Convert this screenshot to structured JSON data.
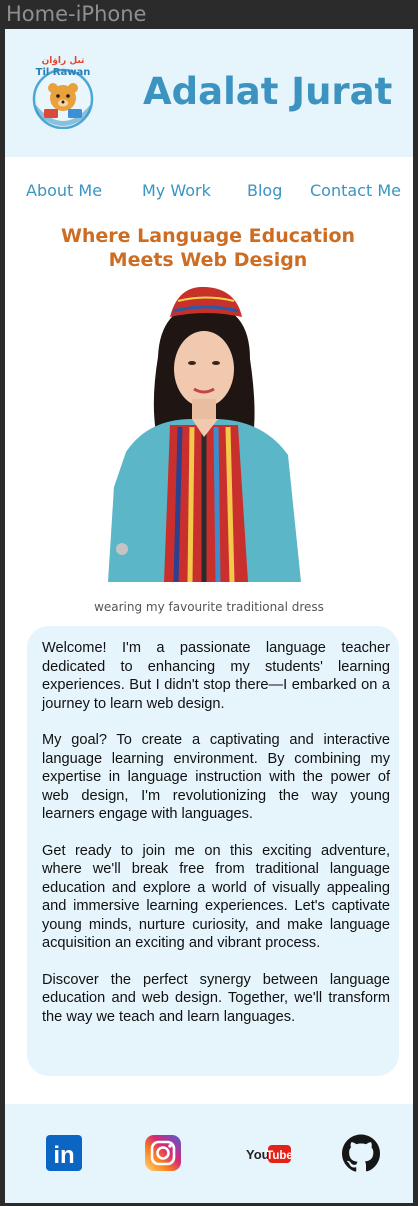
{
  "window": {
    "title": "Home-iPhone"
  },
  "header": {
    "logo_text": "Til Rawan",
    "site_name": "Adalat Jurat"
  },
  "nav": {
    "items": [
      "About Me",
      "My Work",
      "Blog",
      "Contact Me"
    ]
  },
  "hero": {
    "headline": "Where Language Education Meets Web Design",
    "photo_icon": "portrait-photo",
    "caption": "wearing my favourite traditional dress"
  },
  "welcome": {
    "paragraphs": [
      "Welcome! I'm a passionate language teacher dedicated to enhancing my students' learning experiences. But I didn't stop there—I embarked on a journey to learn web design.",
      "My goal? To create a captivating and interactive language learning environment. By combining my expertise in language instruction with the power of web design, I'm revolutionizing the way young learners engage with languages.",
      "Get ready to join me on this exciting adventure, where we'll break free from traditional language education and explore a world of visually appealing and immersive learning experiences. Let's captivate young minds, nurture curiosity, and make language acquisition an exciting and vibrant process.",
      "Discover the perfect synergy between language education and web design. Together, we'll transform the way we teach and learn languages."
    ]
  },
  "footer": {
    "social": [
      {
        "name": "linkedin-icon",
        "label": "in",
        "color": "#0a66c2"
      },
      {
        "name": "instagram-icon",
        "color": "#d62976"
      },
      {
        "name": "youtube-icon",
        "label_you": "You",
        "label_tube": "Tube",
        "color": "#e62117"
      },
      {
        "name": "github-icon",
        "color": "#161616"
      }
    ]
  },
  "colors": {
    "accent_blue": "#3c93c0",
    "headline_orange": "#cd6d23",
    "panel_bg": "#e6f4fc"
  }
}
